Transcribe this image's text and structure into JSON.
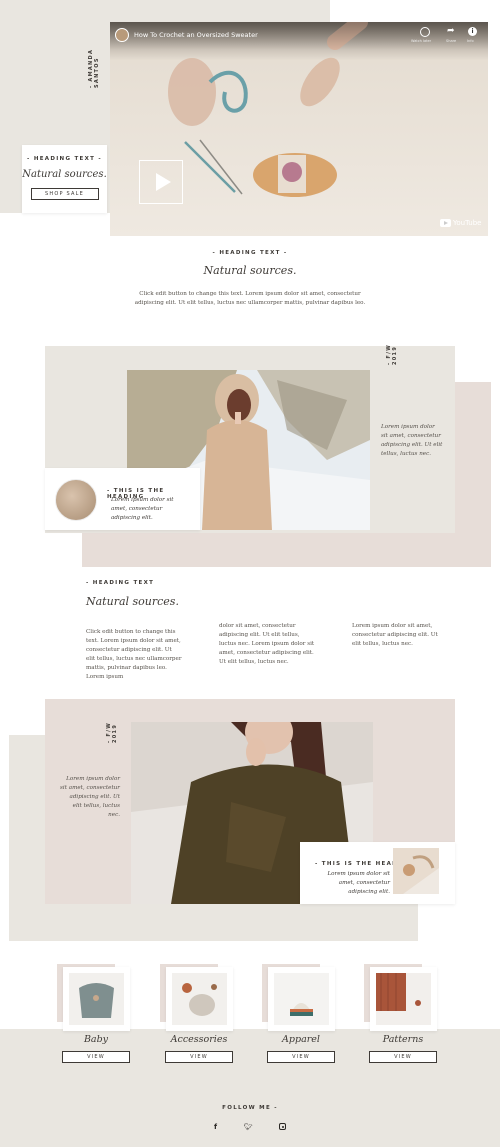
{
  "hero": {
    "vertical_label": "- AMANDA SANTOS",
    "card_kicker": "- HEADING TEXT -",
    "card_title": "Natural sources.",
    "card_button": "SHOP SALE",
    "video_title": "How To Crochet an Oversized Sweater",
    "video_action_1": "Watch later",
    "video_action_2": "Share",
    "video_action_3": "Info",
    "youtube_label": "YouTube"
  },
  "intro": {
    "kicker": "- HEADING TEXT -",
    "title": "Natural sources.",
    "body": "Click edit button to change this text. Lorem ipsum dolor sit amet, consectetur adipiscing elit. Ut elit tellus, luctus nec ullamcorper mattis, pulvinar dapibus leo."
  },
  "feature1": {
    "vertical_label": "- F/W 2019",
    "side_text": "Lorem ipsum dolor sit amet, consectetur adipiscing elit. Ut elit tellus, luctus nec.",
    "card_heading": "- THIS IS THE HEADING",
    "card_text": "Lorem ipsum dolor sit amet, consectetur adipiscing elit."
  },
  "text_section": {
    "kicker": "- HEADING TEXT",
    "title": "Natural sources.",
    "col1": "Click edit button to change this text. Lorem ipsum dolor sit amet, consectetur adipiscing elit. Ut elit tellus, luctus nec ullamcorper mattis, pulvinar dapibus leo.  Lorem ipsum",
    "col2": "dolor sit amet, consectetur adipiscing elit. Ut elit tellus, luctus nec.  Lorem ipsum dolor sit amet, consectetur adipiscing elit. Ut elit tellus, luctus nec.",
    "col3": "Lorem ipsum dolor sit amet, consectetur adipiscing elit. Ut elit tellus, luctus nec."
  },
  "feature2": {
    "vertical_label": "- F/W 2019",
    "side_text": "Lorem ipsum dolor sit amet, consectetur adipiscing elit. Ut elit tellus, luctus nec.",
    "card_heading": "- THIS IS THE HEADING",
    "card_text": "Lorem ipsum dolor sit amet, consectetur adipiscing elit."
  },
  "categories": [
    {
      "label": "Baby",
      "button": "VIEW",
      "icon": "knit-romper"
    },
    {
      "label": "Accessories",
      "button": "VIEW",
      "icon": "yarn-flatlay"
    },
    {
      "label": "Apparel",
      "button": "VIEW",
      "icon": "knit-hat"
    },
    {
      "label": "Patterns",
      "button": "VIEW",
      "icon": "knit-swatch"
    }
  ],
  "footer": {
    "follow_label": "FOLLOW ME -",
    "social": [
      "facebook-icon",
      "twitter-icon",
      "instagram-icon"
    ]
  },
  "colors": {
    "beige": "#e9e6e0",
    "pink": "#e7ddd8",
    "text": "#3e3a36"
  }
}
